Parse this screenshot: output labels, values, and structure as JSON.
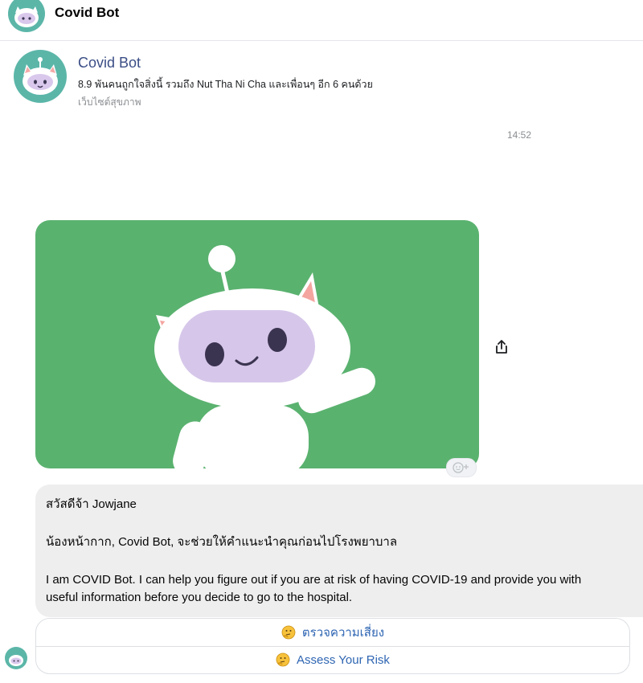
{
  "header": {
    "title": "Covid Bot"
  },
  "profile": {
    "name": "Covid Bot",
    "likes": "8.9 พันคนถูกใจสิ่งนี้ รวมถึง Nut Tha Ni Cha และเพื่อนๆ อีก 6 คนด้วย",
    "category": "เว็บไซต์สุขภาพ"
  },
  "conversation": {
    "timestamp": "14:52",
    "message": {
      "greeting": "สวัสดีจ้า Jowjane",
      "intro_th": "น้องหน้ากาก, Covid Bot, จะช่วยให้คำแนะนำคุณก่อนไปโรงพยาบาล",
      "intro_en": "I am COVID Bot. I can help you figure out if you are at risk of having COVID-19 and provide you with useful information before you decide to go to the hospital."
    },
    "quick_replies": [
      {
        "label": "ตรวจความเสี่ยง",
        "icon": "thinking-face-icon"
      },
      {
        "label": "Assess Your Risk",
        "icon": "thinking-face-icon"
      }
    ]
  },
  "colors": {
    "image_bg": "#5ab26f",
    "avatar_bg": "#5bb6a8",
    "link_blue": "#2f66b3",
    "bubble_bg": "#eeeeee"
  }
}
